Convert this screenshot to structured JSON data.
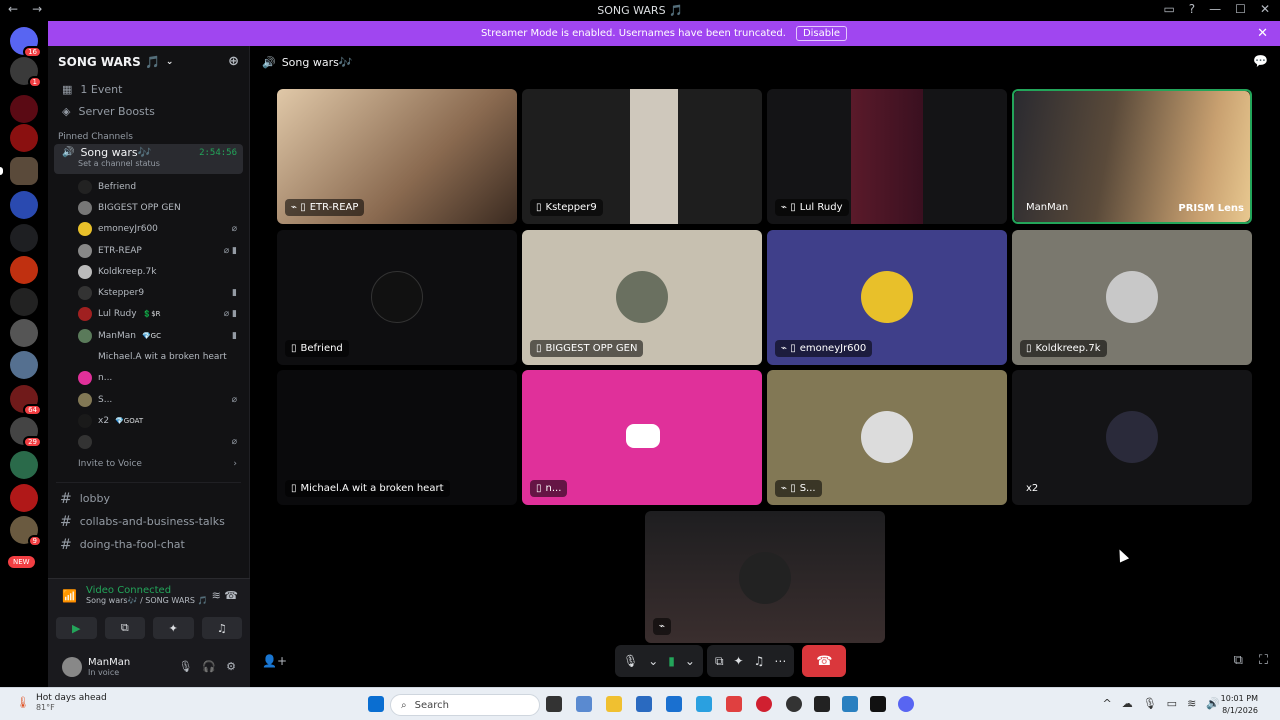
{
  "window": {
    "title": "SONG WARS 🎵",
    "back_icon": "arrow-left-icon",
    "forward_icon": "arrow-right-icon"
  },
  "banner": {
    "text": "Streamer Mode is enabled. Usernames have been truncated.",
    "button": "Disable"
  },
  "guilds": {
    "badges": [
      "16",
      "1",
      "64",
      "29",
      "9",
      "NEW"
    ]
  },
  "sidebar": {
    "server_name": "SONG WARS 🎵",
    "top_items": [
      "1 Event",
      "Server Boosts"
    ],
    "pinned_label": "Pinned Channels",
    "voice_channel": {
      "name": "Song wars🎶",
      "status": "Set a channel status",
      "timer": "2:54:56"
    },
    "members": [
      {
        "name": "Befriend",
        "tag": ""
      },
      {
        "name": "BIGGEST OPP GEN",
        "tag": ""
      },
      {
        "name": "emoneyJr600",
        "tag": ""
      },
      {
        "name": "ETR-REAP",
        "tag": ""
      },
      {
        "name": "Koldkreep.7k",
        "tag": ""
      },
      {
        "name": "Kstepper9",
        "tag": ""
      },
      {
        "name": "Lul Rudy",
        "tag": "💲$R"
      },
      {
        "name": "ManMan",
        "tag": "💎GC"
      },
      {
        "name": "Michael.A wit a broken heart",
        "tag": ""
      },
      {
        "name": "n...",
        "tag": ""
      },
      {
        "name": "S...",
        "tag": ""
      },
      {
        "name": "x2",
        "tag": "💎GOAT"
      },
      {
        "name": "",
        "tag": ""
      }
    ],
    "invite": "Invite to Voice",
    "text_channels": [
      "lobby",
      "collabs-and-business-talks",
      "doing-tha-fool-chat"
    ]
  },
  "voice_panel": {
    "label": "Video Connected",
    "sub": "Song wars🎶 / SONG WARS 🎵"
  },
  "user": {
    "name": "ManMan",
    "status": "In voice"
  },
  "main": {
    "channel_name": "Song wars🎶",
    "tiles": [
      {
        "name": "ETR-REAP",
        "icons": "⌁ ▯",
        "bg": "#c9a98a"
      },
      {
        "name": "Kstepper9",
        "icons": "▯",
        "bg": "#2a2a2a"
      },
      {
        "name": "Lul Rudy",
        "icons": "⌁ ▯",
        "bg": "#2a1a20"
      },
      {
        "name": "ManMan",
        "icons": "",
        "bg": "#6a5a40"
      },
      {
        "name": "Befriend",
        "icons": "▯",
        "bg": "#0e0e10"
      },
      {
        "name": "BIGGEST OPP GEN",
        "icons": "▯",
        "bg": "#c7c0b0"
      },
      {
        "name": "emoney​Jr600",
        "icons": "⌁ ▯",
        "bg": "#3f3f8a"
      },
      {
        "name": "Koldkreep.7k",
        "icons": "▯",
        "bg": "#7a786e"
      },
      {
        "name": "Michael.A wit a broken heart",
        "icons": "▯",
        "bg": "#0a0a0c"
      },
      {
        "name": "n...",
        "icons": "▯",
        "bg": "#e0309a"
      },
      {
        "name": "S...",
        "icons": "⌁ ▯",
        "bg": "#827855"
      },
      {
        "name": "x2",
        "icons": "",
        "bg": "#141416"
      },
      {
        "name": "",
        "icons": "⌁",
        "bg": "#1a1a1c"
      }
    ],
    "manman_overlay": "PRISM Lens"
  },
  "taskbar": {
    "weather_title": "Hot days ahead",
    "weather_temp": "81°F",
    "search": "Search",
    "time": "10:01 PM",
    "date": "8/1/2026"
  }
}
